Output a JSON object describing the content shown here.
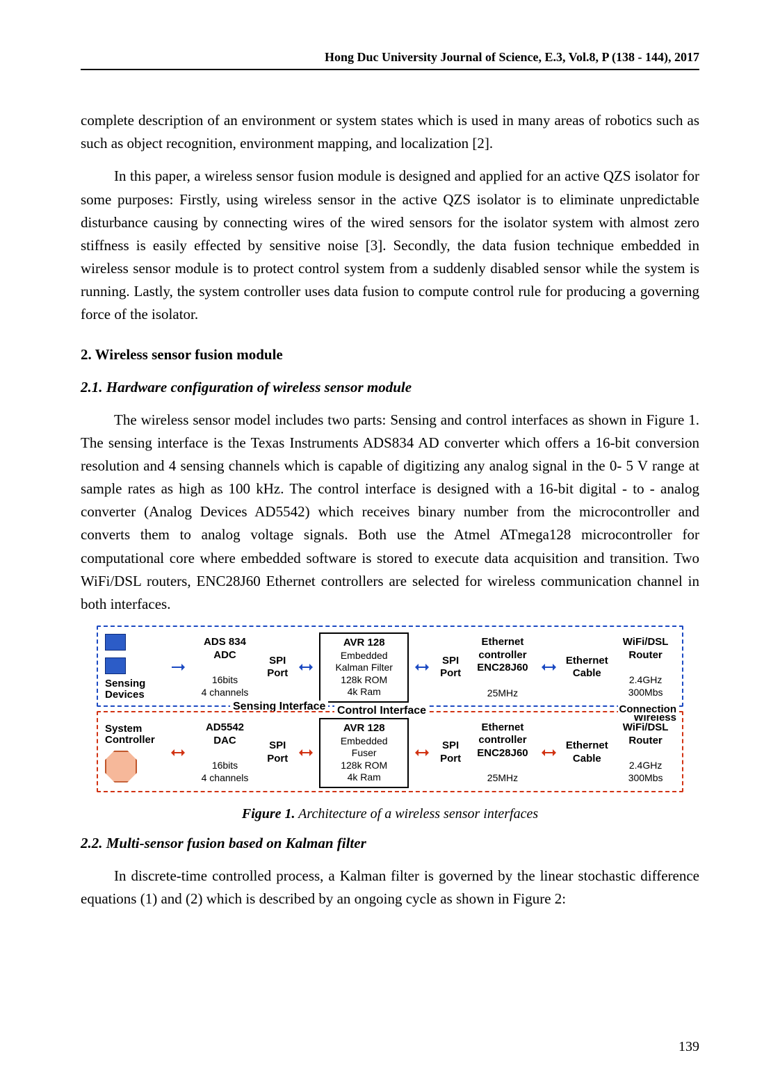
{
  "header": {
    "running": "Hong Duc University Journal of Science, E.3, Vol.8, P (138 - 144), 2017"
  },
  "page_number": "139",
  "paragraphs": {
    "p1": "complete description of an environment or system states which is used in many areas of robotics such as such as object recognition, environment mapping, and localization [2].",
    "p2": "In this paper, a wireless sensor fusion module is designed and applied for an active QZS isolator for some purposes: Firstly, using wireless sensor in the active QZS isolator is to eliminate unpredictable disturbance causing by connecting wires of the wired sensors for the isolator system with almost zero stiffness is easily effected by sensitive noise [3]. Secondly, the data fusion technique embedded in wireless sensor module is to protect control system from a suddenly disabled sensor while the system is running. Lastly, the system controller uses data fusion to compute control rule for producing a governing force of the isolator.",
    "h2": "2. Wireless sensor fusion module",
    "h3a": "2.1. Hardware configuration of wireless sensor module",
    "p3": "The wireless sensor model includes two parts: Sensing and control interfaces as shown in Figure 1. The sensing interface is the Texas Instruments ADS834 AD converter which offers a 16-bit conversion resolution and 4 sensing channels which is capable of digitizing any analog signal in the 0- 5 V range at sample rates as high as 100 kHz. The control interface is designed with a 16-bit digital - to - analog converter (Analog Devices AD5542) which receives binary number from the microcontroller and converts them to analog voltage signals. Both use the Atmel ATmega128 microcontroller for computational core where embedded software is stored to execute data acquisition and transition. Two WiFi/DSL routers, ENC28J60 Ethernet controllers are selected for wireless communication channel in both interfaces.",
    "fig1_lead": "Figure 1.",
    "fig1_title": " Architecture of a wireless sensor interfaces",
    "h3b": "2.2. Multi-sensor fusion based on Kalman filter",
    "p4": "In discrete-time controlled process, a Kalman filter is governed by the linear stochastic difference equations (1) and (2) which is described by an ongoing cycle as shown in Figure 2:"
  },
  "figure": {
    "sense": {
      "label": "Sensing Interface",
      "left_label": "Sensing Devices",
      "adc_l1": "ADS 834",
      "adc_l2": "ADC",
      "adc_l3": "16bits",
      "adc_l4": "4 channels",
      "spi1": "SPI",
      "spi1b": "Port",
      "avr_l1": "AVR 128",
      "avr_l2": "Embedded",
      "avr_l3": "Kalman Filter",
      "avr_l4": "128k ROM",
      "avr_l5": "4k Ram",
      "spi2": "SPI",
      "spi2b": "Port",
      "eth_l1": "Ethernet",
      "eth_l2": "controller",
      "eth_l3": "ENC28J60",
      "eth_l4": "25MHz",
      "cab_l1": "Ethernet",
      "cab_l2": "Cable",
      "wifi_l1": "WiFi/DSL",
      "wifi_l2": "Router",
      "wifi_l3": "2.4GHz",
      "wifi_l4": "300Mbs",
      "wireless_label": "Wireless"
    },
    "control": {
      "label": "Control Interface",
      "left_label": "System Controller",
      "adc_l1": "AD5542",
      "adc_l2": "DAC",
      "adc_l3": "16bits",
      "adc_l4": "4 channels",
      "spi1": "SPI",
      "spi1b": "Port",
      "avr_l1": "AVR 128",
      "avr_l2": "Embedded",
      "avr_l3": "Fuser",
      "avr_l4": "128k ROM",
      "avr_l5": "4k Ram",
      "spi2": "SPI",
      "spi2b": "Port",
      "eth_l1": "Ethernet",
      "eth_l2": "controller",
      "eth_l3": "ENC28J60",
      "eth_l4": "25MHz",
      "cab_l1": "Ethernet",
      "cab_l2": "Cable",
      "wifi_l1": "WiFi/DSL",
      "wifi_l2": "Router",
      "wifi_l3": "2.4GHz",
      "wifi_l4": "300Mbs",
      "wireless_label": "Connection"
    }
  }
}
